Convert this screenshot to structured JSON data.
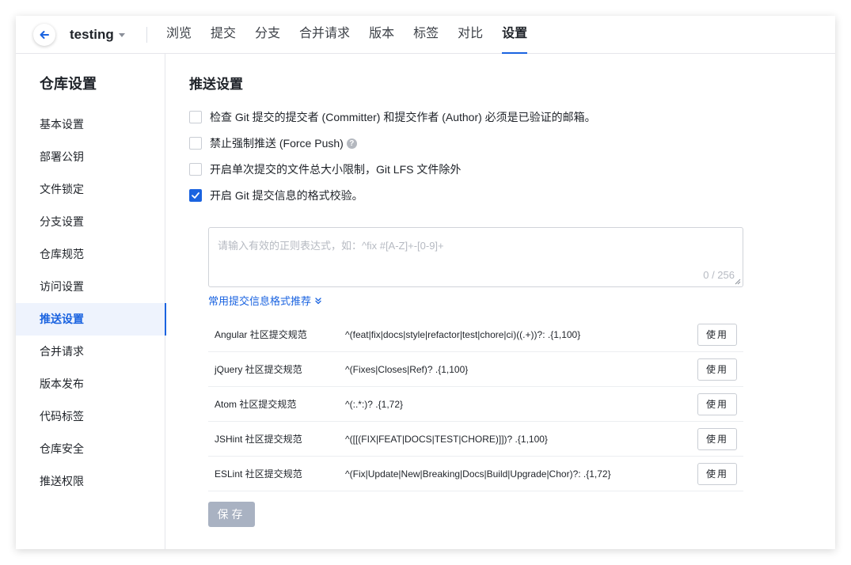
{
  "header": {
    "repo_name": "testing",
    "tabs": [
      {
        "label": "浏览"
      },
      {
        "label": "提交"
      },
      {
        "label": "分支"
      },
      {
        "label": "合并请求"
      },
      {
        "label": "版本"
      },
      {
        "label": "标签"
      },
      {
        "label": "对比"
      },
      {
        "label": "设置",
        "active": true
      }
    ]
  },
  "sidebar": {
    "title": "仓库设置",
    "items": [
      {
        "label": "基本设置"
      },
      {
        "label": "部署公钥"
      },
      {
        "label": "文件锁定"
      },
      {
        "label": "分支设置"
      },
      {
        "label": "仓库规范"
      },
      {
        "label": "访问设置"
      },
      {
        "label": "推送设置",
        "active": true
      },
      {
        "label": "合并请求"
      },
      {
        "label": "版本发布"
      },
      {
        "label": "代码标签"
      },
      {
        "label": "仓库安全"
      },
      {
        "label": "推送权限"
      }
    ]
  },
  "main": {
    "title": "推送设置",
    "options": [
      {
        "label": "检查 Git 提交的提交者 (Committer) 和提交作者 (Author) 必须是已验证的邮箱。",
        "checked": false
      },
      {
        "label": "禁止强制推送 (Force Push)",
        "checked": false,
        "help_icon": "question-circle-icon"
      },
      {
        "label": "开启单次提交的文件总大小限制，Git LFS 文件除外",
        "checked": false
      },
      {
        "label": "开启 Git 提交信息的格式校验。",
        "checked": true
      }
    ],
    "regex_input": {
      "placeholder": "请输入有效的正则表达式，如：^fix #[A-Z]+-[0-9]+",
      "value": "",
      "counter": "0 / 256"
    },
    "recommend_toggle": "常用提交信息格式推荐",
    "recommendations": [
      {
        "name": "Angular 社区提交规范",
        "pattern": "^(feat|fix|docs|style|refactor|test|chore|ci)((.+))?: .{1,100}",
        "button": "使用"
      },
      {
        "name": "jQuery 社区提交规范",
        "pattern": "^(Fixes|Closes|Ref)? .{1,100}",
        "button": "使用"
      },
      {
        "name": "Atom 社区提交规范",
        "pattern": "^(:.*:)? .{1,72}",
        "button": "使用"
      },
      {
        "name": "JSHint 社区提交规范",
        "pattern": "^([[(FIX|FEAT|DOCS|TEST|CHORE)]])? .{1,100}",
        "button": "使用"
      },
      {
        "name": "ESLint 社区提交规范",
        "pattern": "^(Fix|Update|New|Breaking|Docs|Build|Upgrade|Chor)?: .{1,72}",
        "button": "使用"
      }
    ],
    "save_label": "保存"
  },
  "colors": {
    "accent": "#1a63e0",
    "save_disabled": "#a9b2c2"
  }
}
